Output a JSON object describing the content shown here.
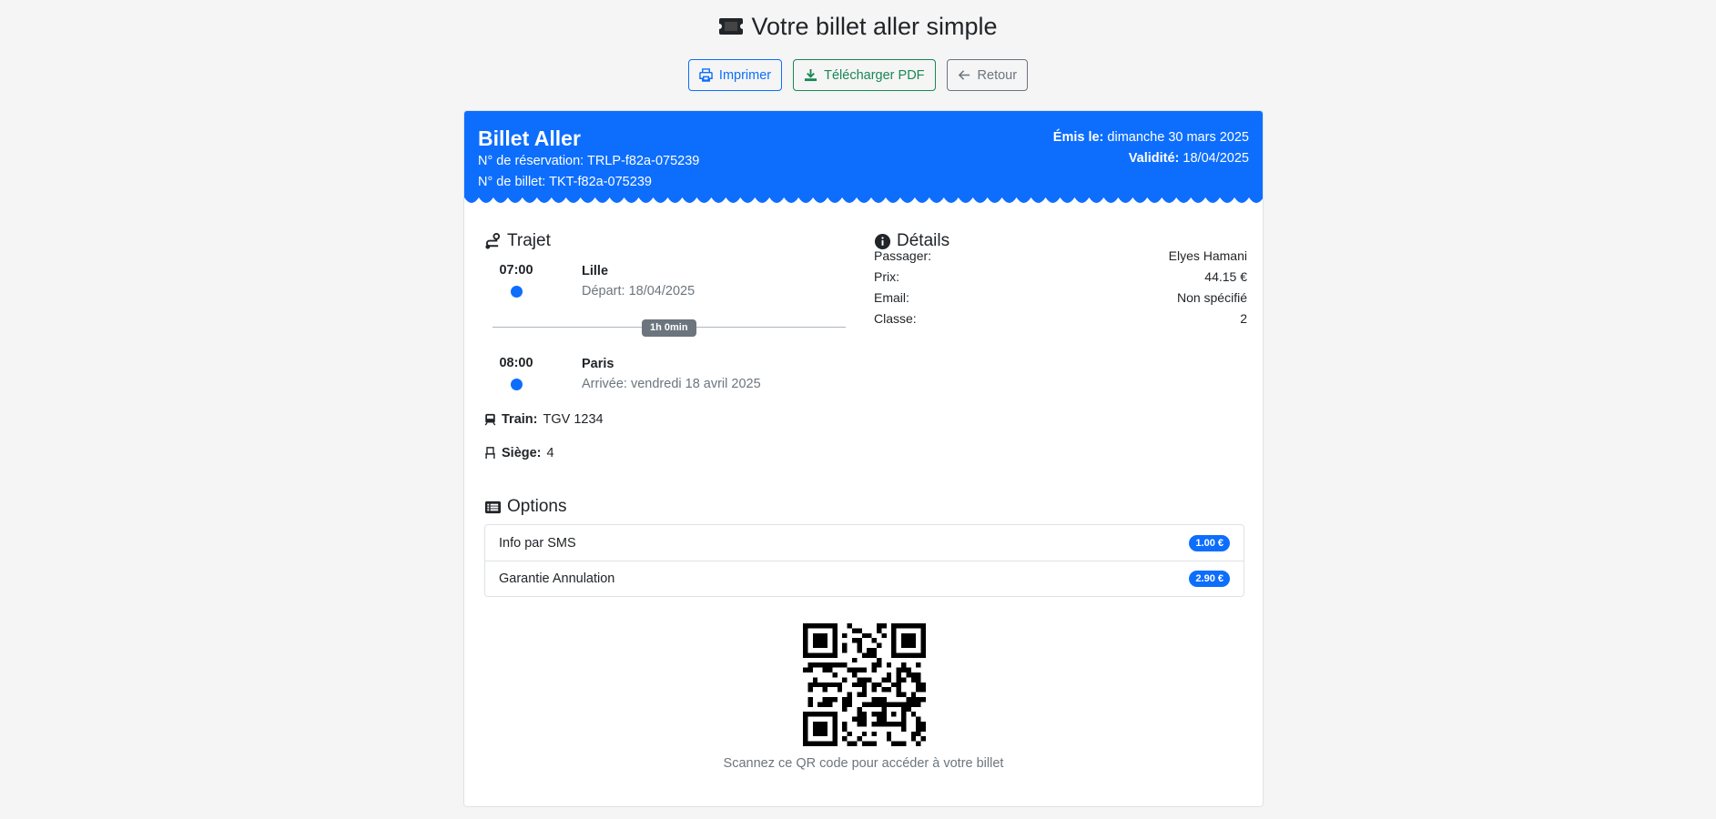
{
  "page": {
    "title": "Votre billet aller simple"
  },
  "toolbar": {
    "print_label": "Imprimer",
    "pdf_label": "Télécharger PDF",
    "back_label": "Retour"
  },
  "ticket": {
    "title": "Billet Aller",
    "reservation_label": "N° de réservation:",
    "reservation_value": "TRLP-f82a-075239",
    "ticket_label": "N° de billet:",
    "ticket_value": "TKT-f82a-075239",
    "issued_label": "Émis le:",
    "issued_value": "dimanche 30 mars 2025",
    "validity_label": "Validité:",
    "validity_value": "18/04/2025"
  },
  "trip": {
    "title": "Trajet",
    "departure": {
      "time": "07:00",
      "city": "Lille",
      "sub": "Départ: 18/04/2025"
    },
    "duration": "1h 0min",
    "arrival": {
      "time": "08:00",
      "city": "Paris",
      "sub": "Arrivée: vendredi 18 avril 2025"
    },
    "train_label": "Train:",
    "train_value": "TGV 1234",
    "seat_label": "Siège:",
    "seat_value": "4"
  },
  "details": {
    "title": "Détails",
    "rows": [
      {
        "label": "Passager:",
        "value": "Elyes Hamani"
      },
      {
        "label": "Prix:",
        "value": "44.15 €"
      },
      {
        "label": "Email:",
        "value": "Non spécifié"
      },
      {
        "label": "Classe:",
        "value": "2"
      }
    ]
  },
  "options": {
    "title": "Options",
    "items": [
      {
        "label": "Info par SMS",
        "price": "1.00 €"
      },
      {
        "label": "Garantie Annulation",
        "price": "2.90 €"
      }
    ]
  },
  "qr": {
    "caption": "Scannez ce QR code pour accéder à votre billet"
  },
  "colors": {
    "primary": "#0d6efd",
    "success": "#198754",
    "secondary": "#6c757d"
  },
  "icons": {
    "title": "ticket-icon",
    "print": "printer-icon",
    "pdf": "download-icon",
    "back": "arrow-left-icon",
    "trip": "route-icon",
    "details": "info-circle-icon",
    "train": "train-icon",
    "seat": "seat-icon",
    "options": "list-icon"
  }
}
